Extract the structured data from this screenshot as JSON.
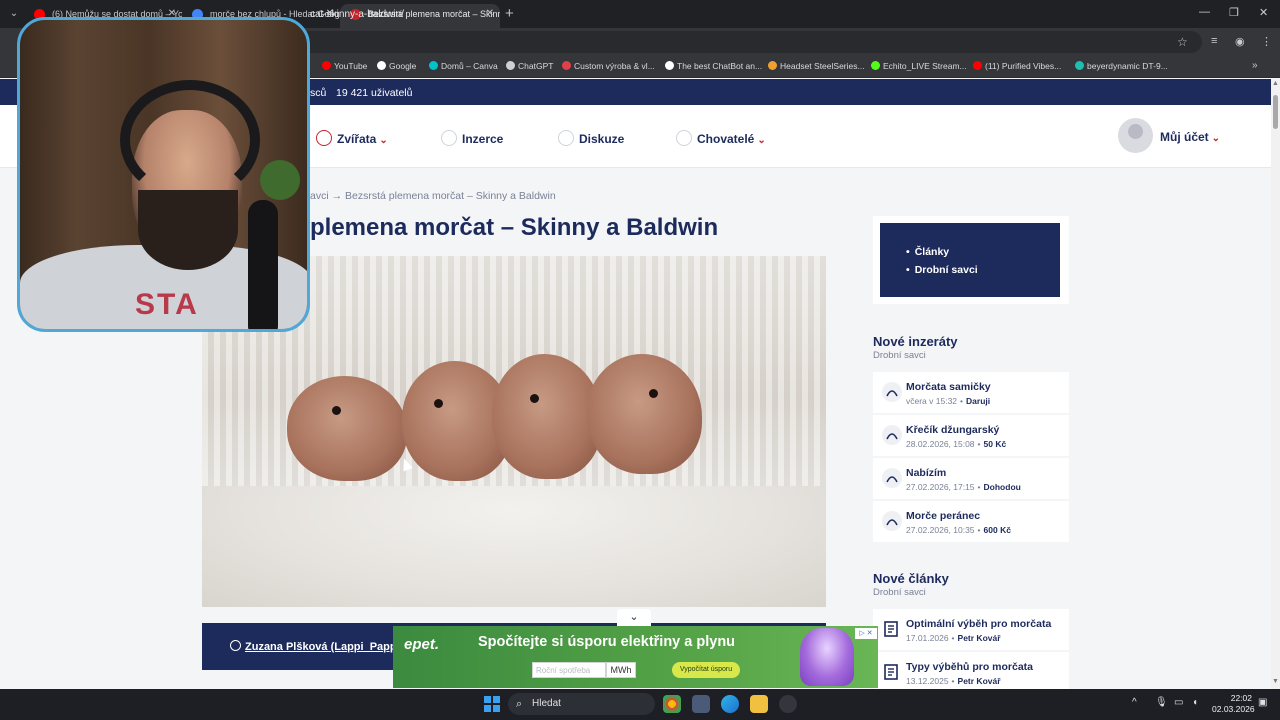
{
  "browser": {
    "tabs": [
      {
        "title": "(6) Nemůžu se dostat domů – YouTube",
        "favicon_color": "#ff0000"
      },
      {
        "title": "morče bez chlupů - Hledat Googlem",
        "favicon_color": "#4285f4"
      },
      {
        "title": "Bezsrstá plemena morčat – Skinny a Baldwin",
        "favicon_color": "#c0272d"
      }
    ],
    "url": "cat-skinny-a-baldwin/",
    "bookmarks": [
      {
        "label": "YouTube",
        "color": "#ff0000"
      },
      {
        "label": "Google",
        "color": "#ffffff"
      },
      {
        "label": "Domů – Canva",
        "color": "#00c4cc"
      },
      {
        "label": "ChatGPT",
        "color": "#d0d0d0"
      },
      {
        "label": "Custom výroba & vl...",
        "color": "#e0404a"
      },
      {
        "label": "The best ChatBot an...",
        "color": "#ffffff"
      },
      {
        "label": "Headset SteelSeries...",
        "color": "#f0a030"
      },
      {
        "label": "Echito_LIVE Stream...",
        "color": "#53fc18"
      },
      {
        "label": "(11) Purified Vibes...",
        "color": "#ff0000"
      },
      {
        "label": "beyerdynamic DT-9...",
        "color": "#1dc0b0"
      }
    ]
  },
  "site": {
    "topbar": {
      "c1": "sců",
      "c2": "19 421 uživatelů"
    },
    "nav": [
      {
        "label": "Zvířata",
        "caret": "⌄"
      },
      {
        "label": "Inzerce",
        "caret": ""
      },
      {
        "label": "Diskuze",
        "caret": ""
      },
      {
        "label": "Chovatelé",
        "caret": "⌄"
      }
    ],
    "account": {
      "label": "Můj účet",
      "caret": "⌄"
    },
    "breadcrumb": "avci → Bezsrstá plemena morčat – Skinny a Baldwin",
    "title": "plemena morčat – Skinny a Baldwin",
    "author": "Zuzana Plšková (Lappi_Pappi)"
  },
  "sidebar": {
    "links": [
      "Články",
      "Drobní savci"
    ],
    "new_ads": {
      "title": "Nové inzeráty",
      "subtitle": "Drobní savci",
      "items": [
        {
          "title": "Morčata samičky",
          "date": "včera v 15:32",
          "price": "Daruji"
        },
        {
          "title": "Křečík džungarský",
          "date": "28.02.2026, 15:08",
          "price": "50 Kč"
        },
        {
          "title": "Nabízím",
          "date": "27.02.2026, 17:15",
          "price": "Dohodou"
        },
        {
          "title": "Morče peránec",
          "date": "27.02.2026, 10:35",
          "price": "600 Kč"
        }
      ]
    },
    "new_articles": {
      "title": "Nové články",
      "subtitle": "Drobní savci",
      "items": [
        {
          "title": "Optimální výběh pro morčata",
          "date": "17.01.2026",
          "author": "Petr Kovář"
        },
        {
          "title": "Typy výběhů pro morčata",
          "date": "13.12.2025",
          "author": "Petr Kovář"
        }
      ]
    }
  },
  "ad": {
    "logo": "epet.",
    "title": "Spočítejte si úsporu elektřiny a plynu",
    "input_placeholder": "Roční spotřeba",
    "unit": "MWh",
    "button": "Vypočítat úsporu",
    "badge": "▷ ✕"
  },
  "taskbar": {
    "search": "Hledat",
    "time": "22:02",
    "date": "02.03.2026"
  },
  "webcam": {
    "shirt_text": "STA"
  }
}
